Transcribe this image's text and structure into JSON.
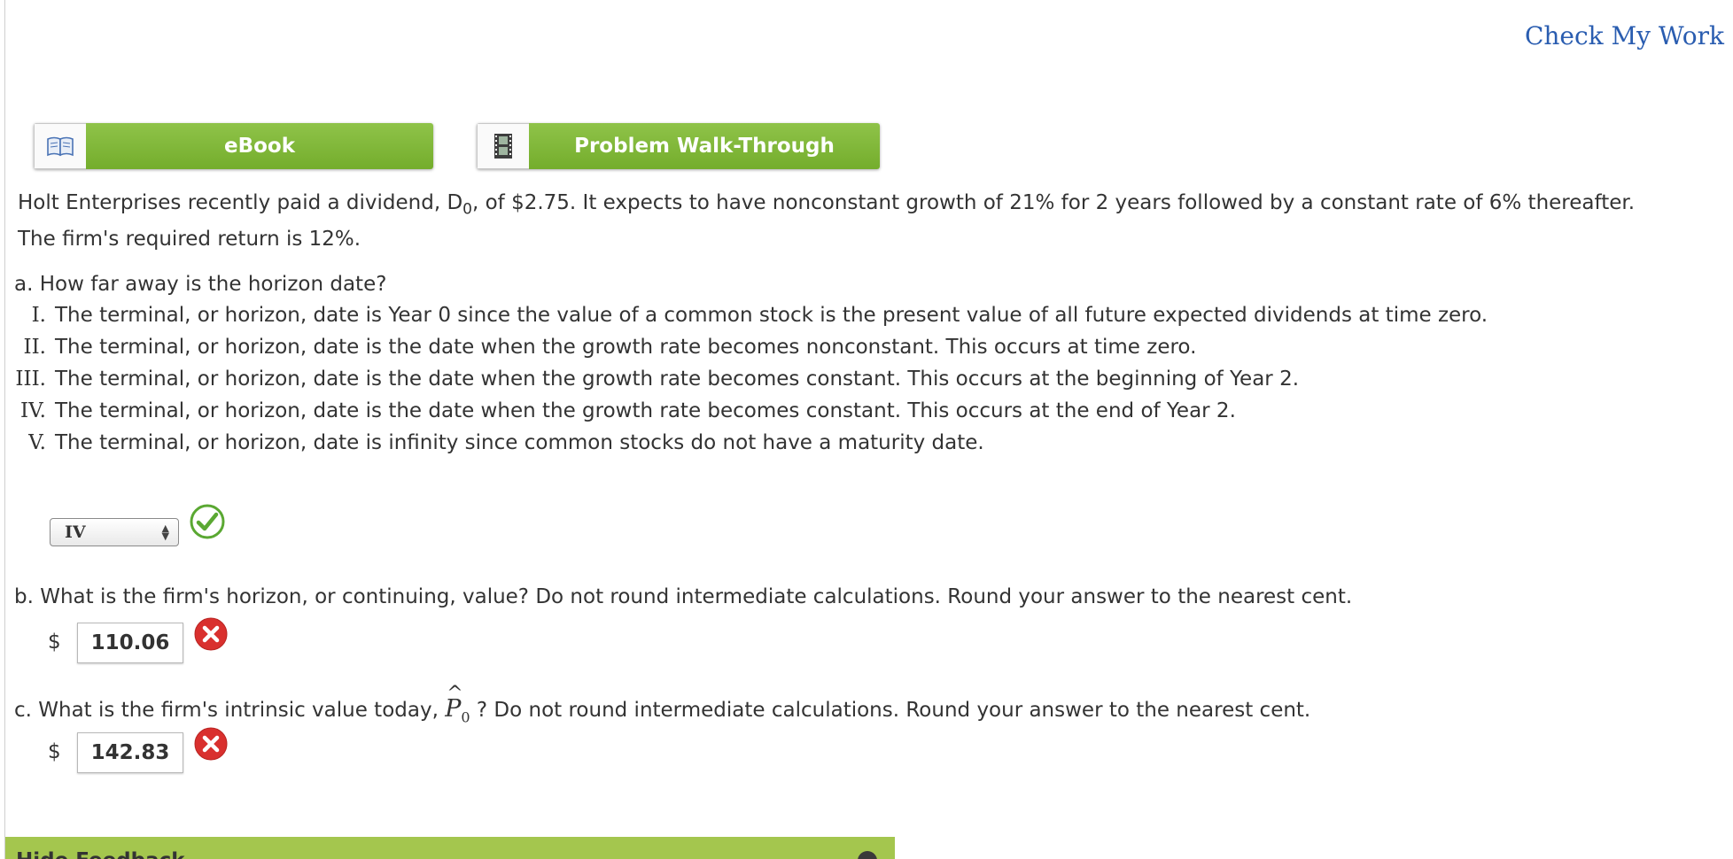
{
  "header": {
    "check_my_work": "Check My Work"
  },
  "tools": {
    "ebook_label": "eBook",
    "ebook_icon": "book-icon",
    "walkthrough_label": "Problem Walk-Through",
    "walkthrough_icon": "film-strip-icon"
  },
  "problem": {
    "intro_before_sub": "Holt Enterprises recently paid a dividend, D",
    "intro_sub": "0",
    "intro_after_sub": ", of $2.75. It expects to have nonconstant growth of 21% for 2 years followed by a constant rate of 6% thereafter.",
    "intro_line2": "The firm's required return is 12%."
  },
  "part_a": {
    "question": "a.  How far away is the horizon date?",
    "options": [
      {
        "numeral": "I.",
        "text": "The terminal, or horizon, date is Year 0 since the value of a common stock is the present value of all future expected dividends at time zero."
      },
      {
        "numeral": "II.",
        "text": "The terminal, or horizon, date is the date when the growth rate becomes nonconstant. This occurs at time zero."
      },
      {
        "numeral": "III.",
        "text": "The terminal, or horizon, date is the date when the growth rate becomes constant. This occurs at the beginning of Year 2."
      },
      {
        "numeral": "IV.",
        "text": "The terminal, or horizon, date is the date when the growth rate becomes constant. This occurs at the end of Year 2."
      },
      {
        "numeral": "V.",
        "text": "The terminal, or horizon, date is infinity since common stocks do not have a maturity date."
      }
    ],
    "selected": "IV",
    "status": "correct"
  },
  "part_b": {
    "question": "b.  What is the firm's horizon, or continuing, value? Do not round intermediate calculations. Round your answer to the nearest cent.",
    "currency": "$",
    "answer": "110.06",
    "status": "incorrect"
  },
  "part_c": {
    "question_before": "c.  What is the firm's intrinsic value today, ",
    "p_symbol": "P",
    "p_sub": "0",
    "question_after": " ? Do not round intermediate calculations. Round your answer to the nearest cent.",
    "currency": "$",
    "answer": "142.83",
    "status": "incorrect"
  },
  "feedback": {
    "label": "Hide Feedback"
  },
  "colors": {
    "green_button": "#7cb342",
    "link_blue": "#2a5db0",
    "correct_green": "#5aa832",
    "incorrect_red": "#d9302e",
    "feedback_bar": "#a4c64e"
  }
}
